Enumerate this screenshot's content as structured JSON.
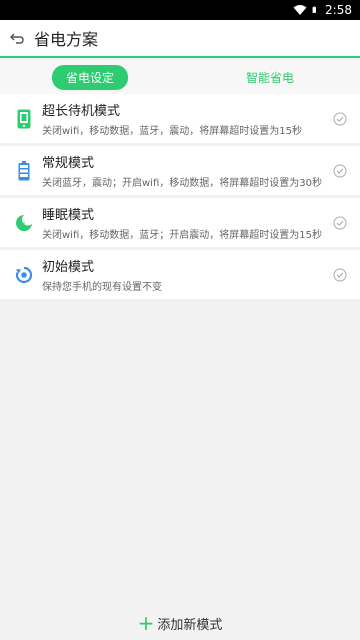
{
  "status_bar": {
    "time": "2:58",
    "icons": [
      "wifi-icon",
      "battery-icon"
    ]
  },
  "toolbar": {
    "back_icon": "back-arrow-icon",
    "title": "省电方案"
  },
  "tabs": [
    {
      "label": "省电设定",
      "active": true
    },
    {
      "label": "智能省电",
      "active": false
    }
  ],
  "modes": [
    {
      "title": "超长待机模式",
      "desc": "关闭wifi，移动数据，蓝牙，震动，将屏幕超时设置为15秒",
      "icon": "phone-battery-icon"
    },
    {
      "title": "常规模式",
      "desc": "关闭蓝牙，震动；开启wifi，移动数据，将屏幕超时设置为30秒",
      "icon": "battery-icon"
    },
    {
      "title": "睡眠模式",
      "desc": "关闭wifi，移动数据，蓝牙；开启震动，将屏幕超时设置为15秒",
      "icon": "moon-icon"
    },
    {
      "title": "初始模式",
      "desc": "保持您手机的现有设置不变",
      "icon": "restore-icon"
    }
  ],
  "bottom": {
    "add_label": "添加新模式",
    "add_icon": "plus-icon"
  },
  "colors": {
    "accent": "#2ecc71",
    "blue": "#3a8ee6"
  }
}
